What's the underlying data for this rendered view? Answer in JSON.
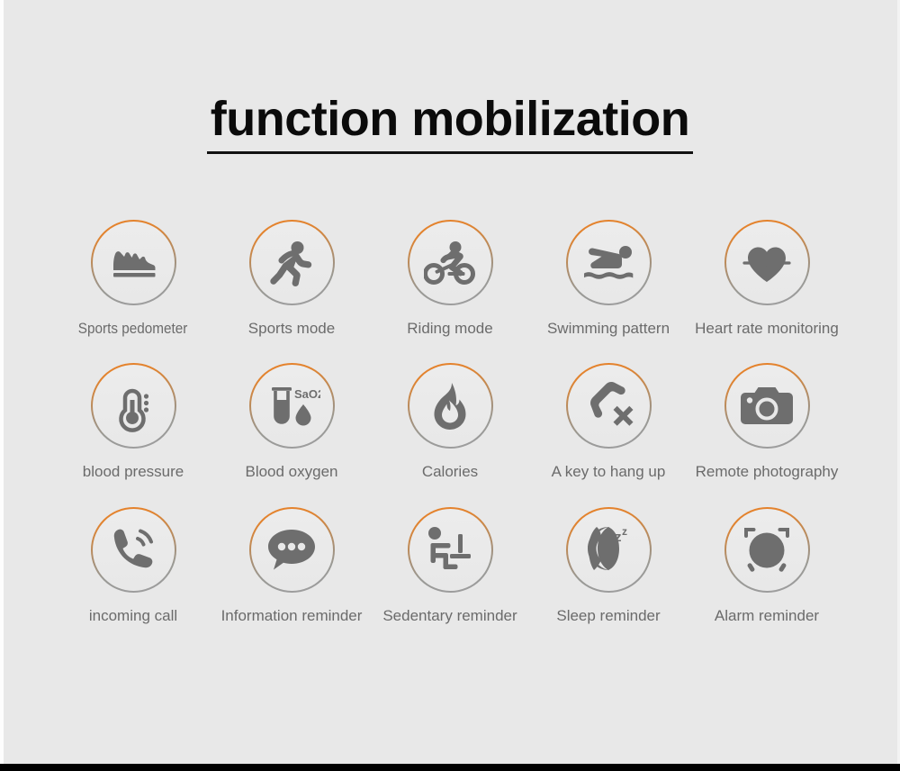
{
  "page": {
    "title": "function mobilization",
    "background_color": "#e8e8e8",
    "accent_color": "#e8822a",
    "icon_color": "#6e6e6e",
    "label_color": "#6b6b6b"
  },
  "features": {
    "row1": [
      {
        "label": "Sports pedometer",
        "icon": "running-shoe-icon"
      },
      {
        "label": "Sports mode",
        "icon": "running-person-icon"
      },
      {
        "label": "Riding mode",
        "icon": "cyclist-icon"
      },
      {
        "label": "Swimming pattern",
        "icon": "swimmer-icon"
      },
      {
        "label": "Heart rate monitoring",
        "icon": "heart-pulse-icon"
      }
    ],
    "row2": [
      {
        "label": "blood pressure",
        "icon": "thermometer-icon"
      },
      {
        "label": "Blood oxygen",
        "icon": "test-tube-icon",
        "badge_text": "SaO2"
      },
      {
        "label": "Calories",
        "icon": "flame-icon"
      },
      {
        "label": "A key to hang up",
        "icon": "phone-hangup-icon"
      },
      {
        "label": "Remote photography",
        "icon": "camera-icon"
      }
    ],
    "row3": [
      {
        "label": "incoming call",
        "icon": "phone-ringing-icon"
      },
      {
        "label": "Information reminder",
        "icon": "speech-bubble-icon"
      },
      {
        "label": "Sedentary reminder",
        "icon": "seated-person-icon"
      },
      {
        "label": "Sleep reminder",
        "icon": "moon-zzz-icon"
      },
      {
        "label": "Alarm reminder",
        "icon": "alarm-clock-icon"
      }
    ]
  }
}
